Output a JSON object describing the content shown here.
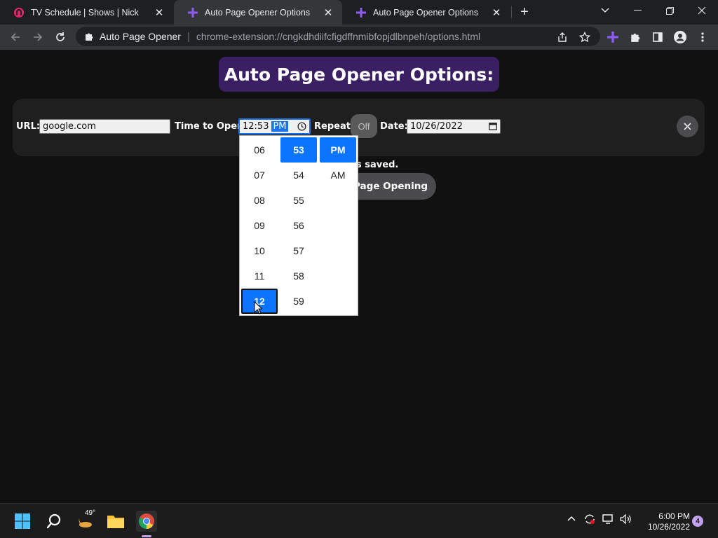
{
  "browser": {
    "tabs": [
      {
        "title": "TV Schedule | Shows | Nick",
        "icon": "nick-favicon-icon",
        "active": false
      },
      {
        "title": "Auto Page Opener Options",
        "icon": "extension-plus-icon",
        "active": true
      },
      {
        "title": "Auto Page Opener Options",
        "icon": "extension-plus-icon",
        "active": false
      }
    ],
    "omnibox": {
      "site_name": "Auto Page Opener",
      "url": "chrome-extension://cngkdhdiifcfigdffnmibfopjdlbnpeh/options.html"
    }
  },
  "page": {
    "title": "Auto Page Opener Options:",
    "row": {
      "url_label": "URL:",
      "url_value": "google.com",
      "time_label": "Time to Open:",
      "time_value": "12:53",
      "time_ampm": "PM",
      "repeat_label": "Repeat:",
      "repeat_value": "Off",
      "date_label": "Date:",
      "date_value": "10/26/2022"
    },
    "saved_fragment": "s saved.",
    "start_button_fragment": "Page Opening"
  },
  "time_picker": {
    "hours": [
      "06",
      "07",
      "08",
      "09",
      "10",
      "11",
      "12"
    ],
    "minutes": [
      "53",
      "54",
      "55",
      "56",
      "57",
      "58",
      "59"
    ],
    "ampm": [
      "PM",
      "AM"
    ],
    "selected_hour": "12",
    "selected_minute": "53",
    "selected_ampm": "PM"
  },
  "taskbar": {
    "weather_temp": "49°",
    "time": "6:00 PM",
    "date": "10/26/2022",
    "notification_count": "4"
  },
  "colors": {
    "title_bg": "#3b1f63",
    "accent": "#0a74ff",
    "extension_purple": "#8e5cf7"
  }
}
